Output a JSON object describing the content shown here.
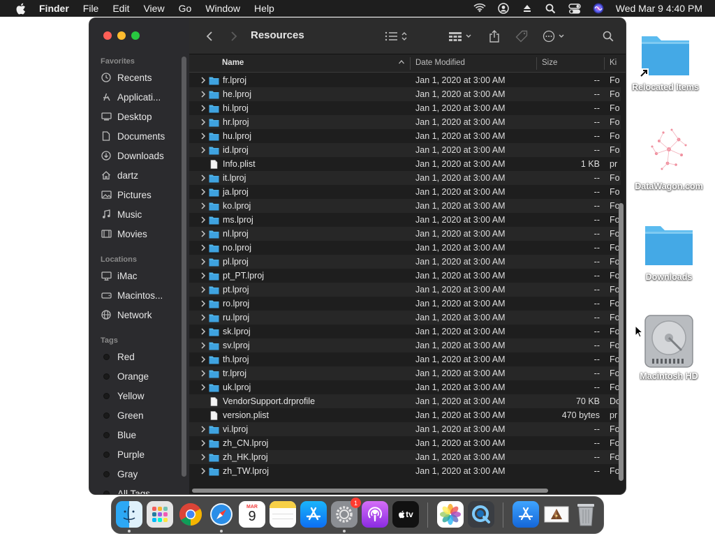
{
  "menubar": {
    "app": "Finder",
    "items": [
      "File",
      "Edit",
      "View",
      "Go",
      "Window",
      "Help"
    ],
    "clock": "Wed Mar 9  4:40 PM"
  },
  "window": {
    "title": "Resources",
    "columns": {
      "name": "Name",
      "date": "Date Modified",
      "size": "Size",
      "kind": "Ki"
    }
  },
  "sidebar": {
    "favorites_heading": "Favorites",
    "favorites": [
      {
        "label": "Recents",
        "icon": "clock-icon"
      },
      {
        "label": "Applicati...",
        "icon": "applications-icon"
      },
      {
        "label": "Desktop",
        "icon": "desktop-icon"
      },
      {
        "label": "Documents",
        "icon": "document-icon"
      },
      {
        "label": "Downloads",
        "icon": "download-icon"
      },
      {
        "label": "dartz",
        "icon": "home-icon"
      },
      {
        "label": "Pictures",
        "icon": "pictures-icon"
      },
      {
        "label": "Music",
        "icon": "music-icon"
      },
      {
        "label": "Movies",
        "icon": "movies-icon"
      }
    ],
    "locations_heading": "Locations",
    "locations": [
      {
        "label": "iMac",
        "icon": "imac-icon"
      },
      {
        "label": "Macintos...",
        "icon": "disk-icon"
      },
      {
        "label": "Network",
        "icon": "network-icon"
      }
    ],
    "tags_heading": "Tags",
    "tags": [
      "Red",
      "Orange",
      "Yellow",
      "Green",
      "Blue",
      "Purple",
      "Gray",
      "All Tags..."
    ]
  },
  "files": [
    {
      "name": "fr.lproj",
      "folder": true,
      "date": "Jan 1, 2020 at 3:00 AM",
      "size": "--",
      "kind": "Fo"
    },
    {
      "name": "he.lproj",
      "folder": true,
      "date": "Jan 1, 2020 at 3:00 AM",
      "size": "--",
      "kind": "Fo"
    },
    {
      "name": "hi.lproj",
      "folder": true,
      "date": "Jan 1, 2020 at 3:00 AM",
      "size": "--",
      "kind": "Fo"
    },
    {
      "name": "hr.lproj",
      "folder": true,
      "date": "Jan 1, 2020 at 3:00 AM",
      "size": "--",
      "kind": "Fo"
    },
    {
      "name": "hu.lproj",
      "folder": true,
      "date": "Jan 1, 2020 at 3:00 AM",
      "size": "--",
      "kind": "Fo"
    },
    {
      "name": "id.lproj",
      "folder": true,
      "date": "Jan 1, 2020 at 3:00 AM",
      "size": "--",
      "kind": "Fo"
    },
    {
      "name": "Info.plist",
      "folder": false,
      "date": "Jan 1, 2020 at 3:00 AM",
      "size": "1 KB",
      "kind": "pr"
    },
    {
      "name": "it.lproj",
      "folder": true,
      "date": "Jan 1, 2020 at 3:00 AM",
      "size": "--",
      "kind": "Fo"
    },
    {
      "name": "ja.lproj",
      "folder": true,
      "date": "Jan 1, 2020 at 3:00 AM",
      "size": "--",
      "kind": "Fo"
    },
    {
      "name": "ko.lproj",
      "folder": true,
      "date": "Jan 1, 2020 at 3:00 AM",
      "size": "--",
      "kind": "Fo"
    },
    {
      "name": "ms.lproj",
      "folder": true,
      "date": "Jan 1, 2020 at 3:00 AM",
      "size": "--",
      "kind": "Fo"
    },
    {
      "name": "nl.lproj",
      "folder": true,
      "date": "Jan 1, 2020 at 3:00 AM",
      "size": "--",
      "kind": "Fo"
    },
    {
      "name": "no.lproj",
      "folder": true,
      "date": "Jan 1, 2020 at 3:00 AM",
      "size": "--",
      "kind": "Fo"
    },
    {
      "name": "pl.lproj",
      "folder": true,
      "date": "Jan 1, 2020 at 3:00 AM",
      "size": "--",
      "kind": "Fo"
    },
    {
      "name": "pt_PT.lproj",
      "folder": true,
      "date": "Jan 1, 2020 at 3:00 AM",
      "size": "--",
      "kind": "Fo"
    },
    {
      "name": "pt.lproj",
      "folder": true,
      "date": "Jan 1, 2020 at 3:00 AM",
      "size": "--",
      "kind": "Fo"
    },
    {
      "name": "ro.lproj",
      "folder": true,
      "date": "Jan 1, 2020 at 3:00 AM",
      "size": "--",
      "kind": "Fo"
    },
    {
      "name": "ru.lproj",
      "folder": true,
      "date": "Jan 1, 2020 at 3:00 AM",
      "size": "--",
      "kind": "Fo"
    },
    {
      "name": "sk.lproj",
      "folder": true,
      "date": "Jan 1, 2020 at 3:00 AM",
      "size": "--",
      "kind": "Fo"
    },
    {
      "name": "sv.lproj",
      "folder": true,
      "date": "Jan 1, 2020 at 3:00 AM",
      "size": "--",
      "kind": "Fo"
    },
    {
      "name": "th.lproj",
      "folder": true,
      "date": "Jan 1, 2020 at 3:00 AM",
      "size": "--",
      "kind": "Fo"
    },
    {
      "name": "tr.lproj",
      "folder": true,
      "date": "Jan 1, 2020 at 3:00 AM",
      "size": "--",
      "kind": "Fo"
    },
    {
      "name": "uk.lproj",
      "folder": true,
      "date": "Jan 1, 2020 at 3:00 AM",
      "size": "--",
      "kind": "Fo"
    },
    {
      "name": "VendorSupport.drprofile",
      "folder": false,
      "date": "Jan 1, 2020 at 3:00 AM",
      "size": "70 KB",
      "kind": "Do"
    },
    {
      "name": "version.plist",
      "folder": false,
      "date": "Jan 1, 2020 at 3:00 AM",
      "size": "470 bytes",
      "kind": "pr"
    },
    {
      "name": "vi.lproj",
      "folder": true,
      "date": "Jan 1, 2020 at 3:00 AM",
      "size": "--",
      "kind": "Fo"
    },
    {
      "name": "zh_CN.lproj",
      "folder": true,
      "date": "Jan 1, 2020 at 3:00 AM",
      "size": "--",
      "kind": "Fo"
    },
    {
      "name": "zh_HK.lproj",
      "folder": true,
      "date": "Jan 1, 2020 at 3:00 AM",
      "size": "--",
      "kind": "Fo"
    },
    {
      "name": "zh_TW.lproj",
      "folder": true,
      "date": "Jan 1, 2020 at 3:00 AM",
      "size": "--",
      "kind": "Fo"
    }
  ],
  "desktop": {
    "relocated": "Relocated Items",
    "datawagon": "DataWagon.com",
    "downloads": "Downloads",
    "hd": "Macintosh HD"
  },
  "dock": {
    "settings_badge": "1",
    "calendar_month": "MAR",
    "calendar_day": "9",
    "tv_label": "tv"
  },
  "colors": {
    "folder": "#4fb3e8",
    "accent": "#2f7de1"
  }
}
